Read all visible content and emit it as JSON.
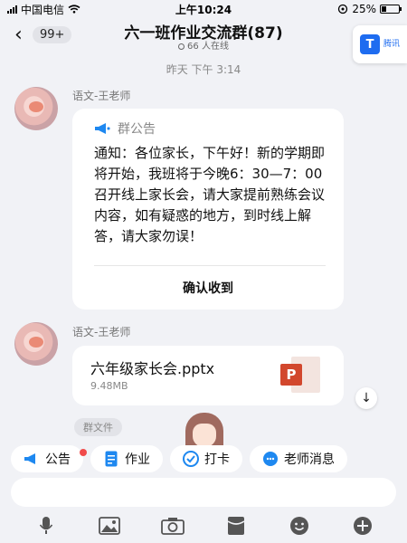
{
  "status_bar": {
    "carrier": "中国电信",
    "time": "上午10:24",
    "battery": "25%",
    "battery_level": 0.25
  },
  "header": {
    "back_count": "99+",
    "title": "六一班作业交流群(87)",
    "online": "66 人在线"
  },
  "timestamp": "昨天 下午 3:14",
  "messages": [
    {
      "sender": "语文-王老师",
      "notice": {
        "label": "群公告",
        "body": "通知：各位家长，下午好！新的学期即将开始，我班将于今晚6：30—7：00召开线上家长会，请大家提前熟练会议内容，如有疑惑的地方，到时线上解答，请大家勿误！",
        "confirm": "确认收到"
      }
    },
    {
      "sender": "语文-王老师",
      "file": {
        "name": "六年级家长会.pptx",
        "size": "9.48MB"
      }
    }
  ],
  "group_file_label": "群文件",
  "float_widget": {
    "name": "腾讯",
    "icon": "tencent-docs-logo"
  },
  "quick_actions": [
    {
      "label": "公告",
      "icon": "megaphone-icon",
      "has_badge": true
    },
    {
      "label": "作业",
      "icon": "document-icon"
    },
    {
      "label": "打卡",
      "icon": "check-circle-icon"
    },
    {
      "label": "老师消息",
      "icon": "chat-bubble-icon"
    }
  ],
  "toolbar_icons": [
    "microphone-icon",
    "image-icon",
    "camera-icon",
    "red-packet-icon",
    "emoji-icon",
    "plus-icon"
  ],
  "colors": {
    "accent": "#1e88f0",
    "badge": "#f14b4b",
    "ppt": "#d2472d"
  }
}
